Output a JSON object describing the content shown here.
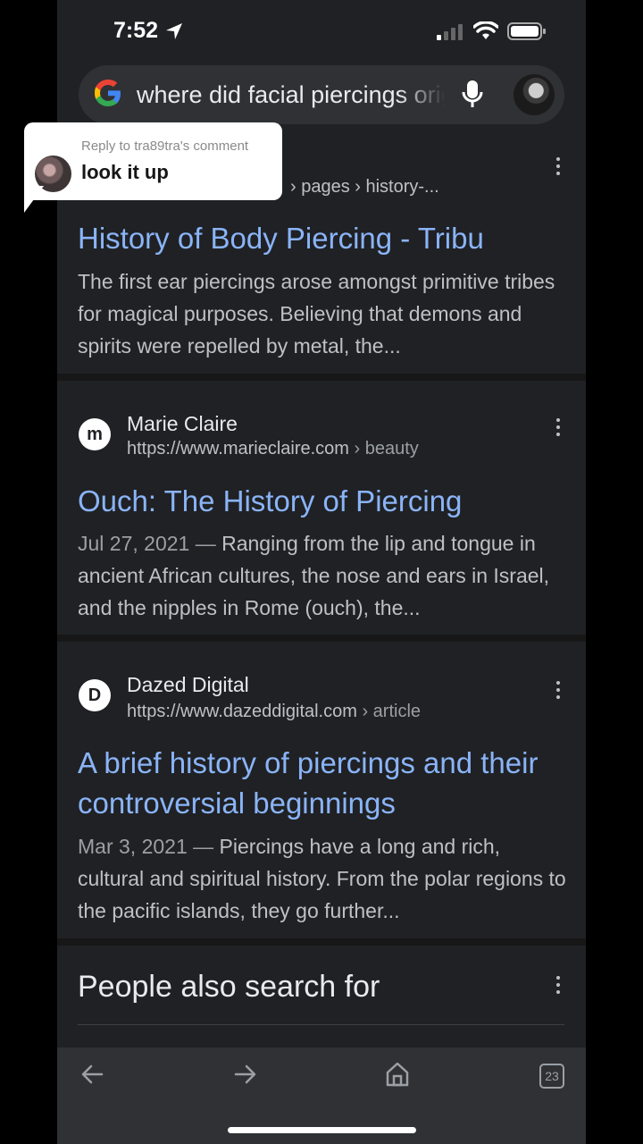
{
  "status_bar": {
    "time": "7:52"
  },
  "search": {
    "query": "where did facial piercings originate"
  },
  "results": [
    {
      "url_crumb": "› pages › history-...",
      "title": "History of Body Piercing - Tribu",
      "snippet": "The first ear piercings arose amongst primitive tribes for magical purposes. Believing that demons and spirits were repelled by metal, the..."
    },
    {
      "site": "Marie Claire",
      "favicon": "m",
      "url": "https://www.marieclaire.com",
      "url_crumb": "› beauty",
      "title": "Ouch: The History of Piercing",
      "date": "Jul 27, 2021 —",
      "snippet": "Ranging from the lip and tongue in ancient African cultures, the nose and ears in Israel, and the nipples in Rome (ouch), the..."
    },
    {
      "site": "Dazed Digital",
      "favicon": "D",
      "url": "https://www.dazeddigital.com",
      "url_crumb": "› article",
      "title": "A brief history of piercings and their controversial beginnings",
      "date": "Mar 3, 2021 —",
      "snippet": "Piercings have a long and rich, cultural and spiritual history. From the polar regions to the pacific islands, they go further..."
    }
  ],
  "people_also_search": {
    "heading": "People also search for"
  },
  "bottom_nav": {
    "tabs_count": "23"
  },
  "comment_toast": {
    "subtitle": "Reply to tra89tra's comment",
    "text": "look it up"
  }
}
